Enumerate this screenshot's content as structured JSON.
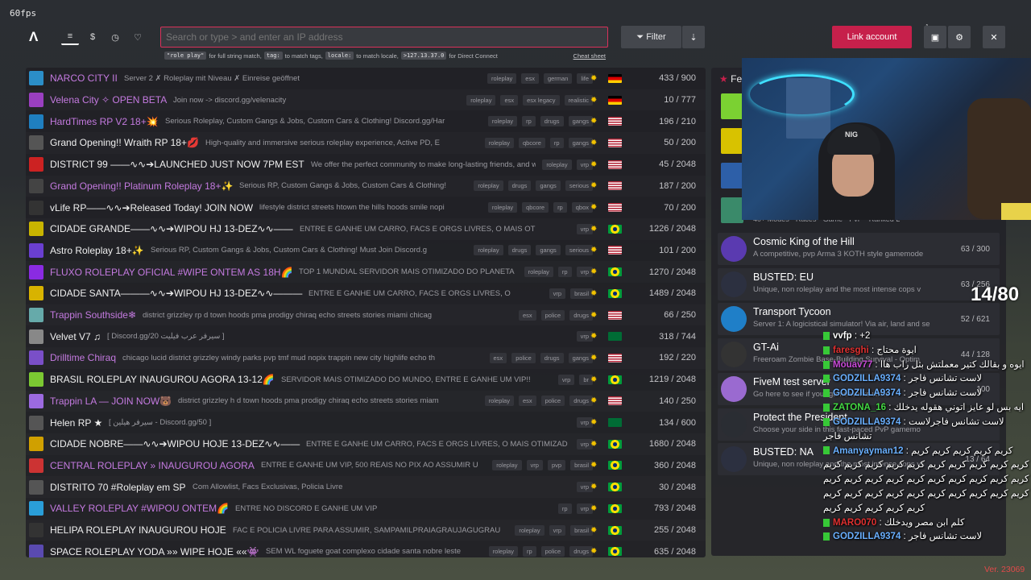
{
  "fps": "60fps",
  "search": {
    "placeholder": "Search or type > and enter an IP address"
  },
  "hints": {
    "h1_code": "\"role play\"",
    "h1_text": "for full string match,",
    "h2_code": "tag:",
    "h2_text": "to match tags,",
    "h3_code": "locale:",
    "h3_text": "to match locale,",
    "h4_code": ">127.13.37.0",
    "h4_text": "for Direct Connect",
    "cheat": "Cheat sheet"
  },
  "toolbar": {
    "filter": "Filter",
    "link": "Link account",
    "badge": "1"
  },
  "colors": {
    "accent": "#c6204b",
    "purple_name": "#c47ae0"
  },
  "servers": [
    {
      "name": "NARCO CITY II",
      "desc": "Server 2 ✗ Roleplay mit Niveau ✗ Einreise geöffnet",
      "tags": [
        "roleplay",
        "esx",
        "german",
        "life"
      ],
      "flag": "de",
      "count": "433 / 900",
      "purple": true
    },
    {
      "name": "Velena City ✧ OPEN BETA",
      "desc": "Join now -> discord.gg/velenacity",
      "tags": [
        "roleplay",
        "esx",
        "esx legacy",
        "realistic"
      ],
      "flag": "de",
      "count": "10 / 777",
      "purple": true
    },
    {
      "name": "HardTimes RP V2 18+💥",
      "desc": "Serious Roleplay, Custom Gangs & Jobs, Custom Cars & Clothing! Discord.gg/Har",
      "tags": [
        "roleplay",
        "rp",
        "drugs",
        "gangs"
      ],
      "flag": "us",
      "count": "196 / 210",
      "purple": true
    },
    {
      "name": "Grand Opening!! Wraith RP 18+💋",
      "desc": "High-quality and immersive serious roleplay experience, Active PD, E",
      "tags": [
        "roleplay",
        "qbcore",
        "rp",
        "gangs"
      ],
      "flag": "us",
      "count": "50 / 200",
      "purple": false
    },
    {
      "name": "DISTRICT 99 ——∿∿➔LAUNCHED JUST NOW 7PM EST",
      "desc": "We offer the perfect community to make long-lasting friends, and we a",
      "tags": [
        "roleplay",
        "vrp"
      ],
      "flag": "us",
      "count": "45 / 2048",
      "purple": false
    },
    {
      "name": "Grand Opening!! Platinum Roleplay 18+✨",
      "desc": "Serious RP, Custom Gangs & Jobs, Custom Cars & Clothing!",
      "tags": [
        "roleplay",
        "drugs",
        "gangs",
        "serious"
      ],
      "flag": "us",
      "count": "187 / 200",
      "purple": true
    },
    {
      "name": "vLife RP——∿∿➔Released Today! JOIN NOW",
      "desc": "lifestyle district streets htown the hills hoods smile nopi",
      "tags": [
        "roleplay",
        "qbcore",
        "rp",
        "qbox"
      ],
      "flag": "us",
      "count": "70 / 200",
      "purple": false
    },
    {
      "name": "CIDADE GRANDE——∿∿➔WIPOU HJ 13-DEZ∿∿——",
      "desc": "ENTRE E GANHE UM CARRO, FACS E ORGS LIVRES, O MAIS OT",
      "tags": [
        "vrp"
      ],
      "flag": "br",
      "count": "1226 / 2048",
      "purple": false
    },
    {
      "name": "Astro Roleplay 18+✨",
      "desc": "Serious RP, Custom Gangs & Jobs, Custom Cars & Clothing! Must Join Discord.g",
      "tags": [
        "roleplay",
        "drugs",
        "gangs",
        "serious"
      ],
      "flag": "us",
      "count": "101 / 200",
      "purple": false
    },
    {
      "name": "FLUXO ROLEPLAY OFICIAL #WIPE ONTEM AS 18H🌈",
      "desc": "TOP 1 MUNDIAL SERVIDOR MAIS OTIMIZADO DO PLANETA",
      "tags": [
        "roleplay",
        "rp",
        "vrp"
      ],
      "flag": "br",
      "count": "1270 / 2048",
      "purple": true
    },
    {
      "name": "CIDADE SANTA———∿∿➔WIPOU HJ 13-DEZ∿∿———",
      "desc": "ENTRE E GANHE UM CARRO, FACS E ORGS LIVRES, O",
      "tags": [
        "vrp",
        "brasil"
      ],
      "flag": "br",
      "count": "1489 / 2048",
      "purple": false
    },
    {
      "name": "Trappin Southside❄",
      "desc": "district grizzley rp d town hoods pma prodigy chiraq echo streets stories miami chicag",
      "tags": [
        "esx",
        "police",
        "drugs"
      ],
      "flag": "us",
      "count": "66 / 250",
      "purple": true
    },
    {
      "name": "Velvet V7 ♫",
      "desc": "[ Discord.gg/20 سيرفر عرب فيليت ]",
      "tags": [
        "vrp"
      ],
      "flag": "sa",
      "count": "318 / 744",
      "purple": false
    },
    {
      "name": "Drilltime Chiraq",
      "desc": "chicago lucid district grizzley windy parks pvp tmf mud nopix trappin new city highlife echo th",
      "tags": [
        "esx",
        "police",
        "drugs",
        "gangs"
      ],
      "flag": "us",
      "count": "192 / 220",
      "purple": true
    },
    {
      "name": "BRASIL ROLEPLAY INAUGUROU AGORA 13-12🌈",
      "desc": "SERVIDOR MAIS OTIMIZADO DO MUNDO, ENTRE E GANHE UM VIP!!",
      "tags": [
        "vrp",
        "br"
      ],
      "flag": "br",
      "count": "1219 / 2048",
      "purple": false
    },
    {
      "name": "Trappin LA — JOIN NOW🐻",
      "desc": "district grizzley h d town hoods pma prodigy chiraq echo streets stories miam",
      "tags": [
        "roleplay",
        "esx",
        "police",
        "drugs"
      ],
      "flag": "us",
      "count": "140 / 250",
      "purple": true
    },
    {
      "name": "Helen RP ★",
      "desc": "[ سيرفر هيلين - Discord.gg/50 ]",
      "tags": [
        "vrp"
      ],
      "flag": "sa",
      "count": "134 / 600",
      "purple": false
    },
    {
      "name": "CIDADE NOBRE——∿∿➔WIPOU HOJE 13-DEZ∿∿——",
      "desc": "ENTRE E GANHE UM CARRO, FACS E ORGS LIVRES, O MAIS OTIMIZAD",
      "tags": [
        "vrp"
      ],
      "flag": "br",
      "count": "1680 / 2048",
      "purple": false
    },
    {
      "name": "CENTRAL ROLEPLAY » INAUGUROU AGORA",
      "desc": "ENTRE E GANHE UM VIP, 500 REAIS NO PIX AO ASSUMIR U",
      "tags": [
        "roleplay",
        "vrp",
        "pvp",
        "brasil"
      ],
      "flag": "br",
      "count": "360 / 2048",
      "purple": true
    },
    {
      "name": "DISTRITO 70 #Roleplay em SP",
      "desc": "Com Allowlist, Facs Exclusivas, Policia Livre",
      "tags": [
        "vrp"
      ],
      "flag": "br",
      "count": "30 / 2048",
      "purple": false
    },
    {
      "name": "VALLEY ROLEPLAY #WIPOU ONTEM🌈",
      "desc": "ENTRE NO DISCORD E GANHE UM VIP",
      "tags": [
        "rp",
        "vrp"
      ],
      "flag": "br",
      "count": "793 / 2048",
      "purple": true
    },
    {
      "name": "HELIPA ROLEPLAY INAUGUROU HOJE",
      "desc": "FAC E POLICIA LIVRE PARA ASSUMIR, SAMPAMILPRAIAGRAUJAGUGRAU",
      "tags": [
        "roleplay",
        "vrp",
        "brasil"
      ],
      "flag": "br",
      "count": "255 / 2048",
      "purple": false
    },
    {
      "name": "SPACE ROLEPLAY YODA »» WIPE HOJE ««👾",
      "desc": "SEM WL foguete goat complexo cidade santa nobre leste",
      "tags": [
        "roleplay",
        "rp",
        "police",
        "drugs"
      ],
      "flag": "br",
      "count": "635 / 2048",
      "purple": false
    }
  ],
  "featured": {
    "title": "Fe",
    "partial_desc": "40+ Modes • Races • Game • PvP • Ranked L",
    "items": [
      {
        "title": "Cosmic King of the Hill",
        "desc": "A competitive, pvp Arma 3 KOTH style gamemode",
        "count": "63 / 300"
      },
      {
        "title": "BUSTED: EU",
        "desc": "Unique, non roleplay and the most intense cops v",
        "count": "63 / 256"
      },
      {
        "title": "Transport Tycoon",
        "desc": "Server 1: A logicistical simulator! Via air, land and se",
        "count": "52 / 621"
      },
      {
        "title": "GT-Ai",
        "desc": "Freeroam Zombie Base-Building Survival - Optim",
        "count": "44 / 128"
      },
      {
        "title": "FiveM test server",
        "desc": "Go here to see if your game works while",
        "count": "100"
      },
      {
        "title": "Protect the President",
        "desc": "Choose your side in this fast-paced PvP gamemo",
        "count": ""
      },
      {
        "title": "BUSTED: NA",
        "desc": "Unique, non roleplay and the most intense cops vs",
        "count": "13 / 64"
      }
    ]
  },
  "webcam": {
    "beanie_text": "NIG"
  },
  "counter": "14/80",
  "chat": [
    {
      "name": "vvfp",
      "msg": ": +2"
    },
    {
      "name": "faresghi",
      "msg": ": ايوة محتاج"
    },
    {
      "name": "Mouav77",
      "msg": ": ايوه و بقالك كتير معملتش بثل راب هاا"
    },
    {
      "name": "GODZILLA9374",
      "msg": ": لاست تشانس فاجر"
    },
    {
      "name": "GODZILLA9374",
      "msg": ": لاست تشانس فاجر"
    },
    {
      "name": "ZATONA_16",
      "msg": ": ايه بس لو عايز اتوني هقوله يدخلك"
    },
    {
      "name": "GODZILLA9374",
      "msg": ": لاست تشانس فاجرلاست تشانس فاجر"
    },
    {
      "name": "Amanyayman12",
      "msg": ": كريم كريم كريم كريم كريم كريم كريم كريم كريم كريم كريم كريم كريم كريم كريم كريم كريم كريم كريم كريم كريم كريم كريم كريم كريم كريم كريم كريم كريم كريم كريم كريم كريم كريم كريم كريم كريم كريم كريم كريم"
    },
    {
      "name": "MARO070",
      "msg": ": كلم ابن مصر ويدخلك"
    },
    {
      "name": "GODZILLA9374",
      "msg": ": لاست تشانس فاجر"
    }
  ],
  "version": "Ver. 23069"
}
